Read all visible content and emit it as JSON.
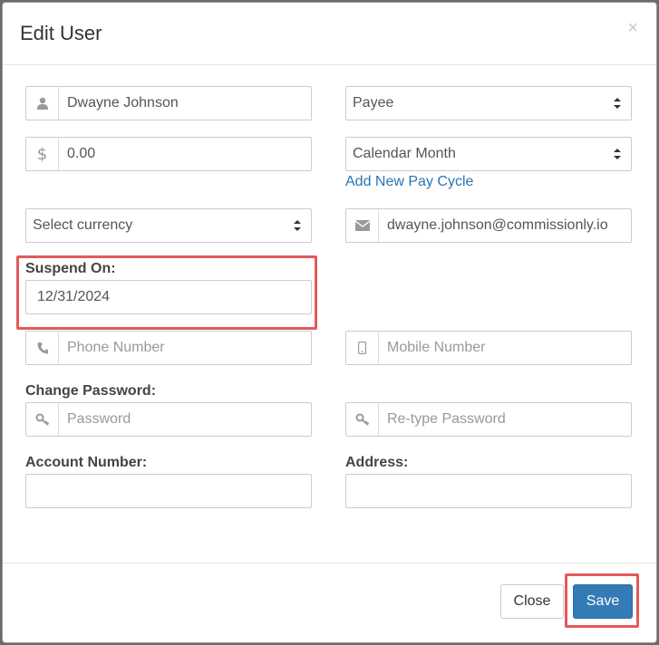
{
  "modal": {
    "title": "Edit User",
    "close_symbol": "×"
  },
  "form": {
    "name": {
      "value": "Dwayne Johnson",
      "icon": "user-icon"
    },
    "role": {
      "selected": "Payee"
    },
    "amount": {
      "value": "0.00",
      "icon": "dollar-icon"
    },
    "pay_cycle": {
      "selected": "Calendar Month"
    },
    "add_pay_cycle_link": "Add New Pay Cycle",
    "currency": {
      "selected": "Select currency"
    },
    "email": {
      "value": "dwayne.johnson@commissionly.io",
      "icon": "envelope-icon"
    },
    "suspend_on": {
      "label": "Suspend On:",
      "value": "12/31/2024"
    },
    "phone": {
      "placeholder": "Phone Number",
      "icon": "phone-icon"
    },
    "mobile": {
      "placeholder": "Mobile Number",
      "icon": "mobile-icon"
    },
    "change_password_label": "Change Password:",
    "password": {
      "placeholder": "Password",
      "icon": "key-icon"
    },
    "retype_password": {
      "placeholder": "Re-type Password",
      "icon": "key-icon"
    },
    "account_number": {
      "label": "Account Number:",
      "value": ""
    },
    "address": {
      "label": "Address:",
      "value": ""
    }
  },
  "footer": {
    "close_label": "Close",
    "save_label": "Save"
  },
  "colors": {
    "primary": "#337ab7",
    "link": "#2a74b5",
    "highlight": "#e35a5a"
  }
}
